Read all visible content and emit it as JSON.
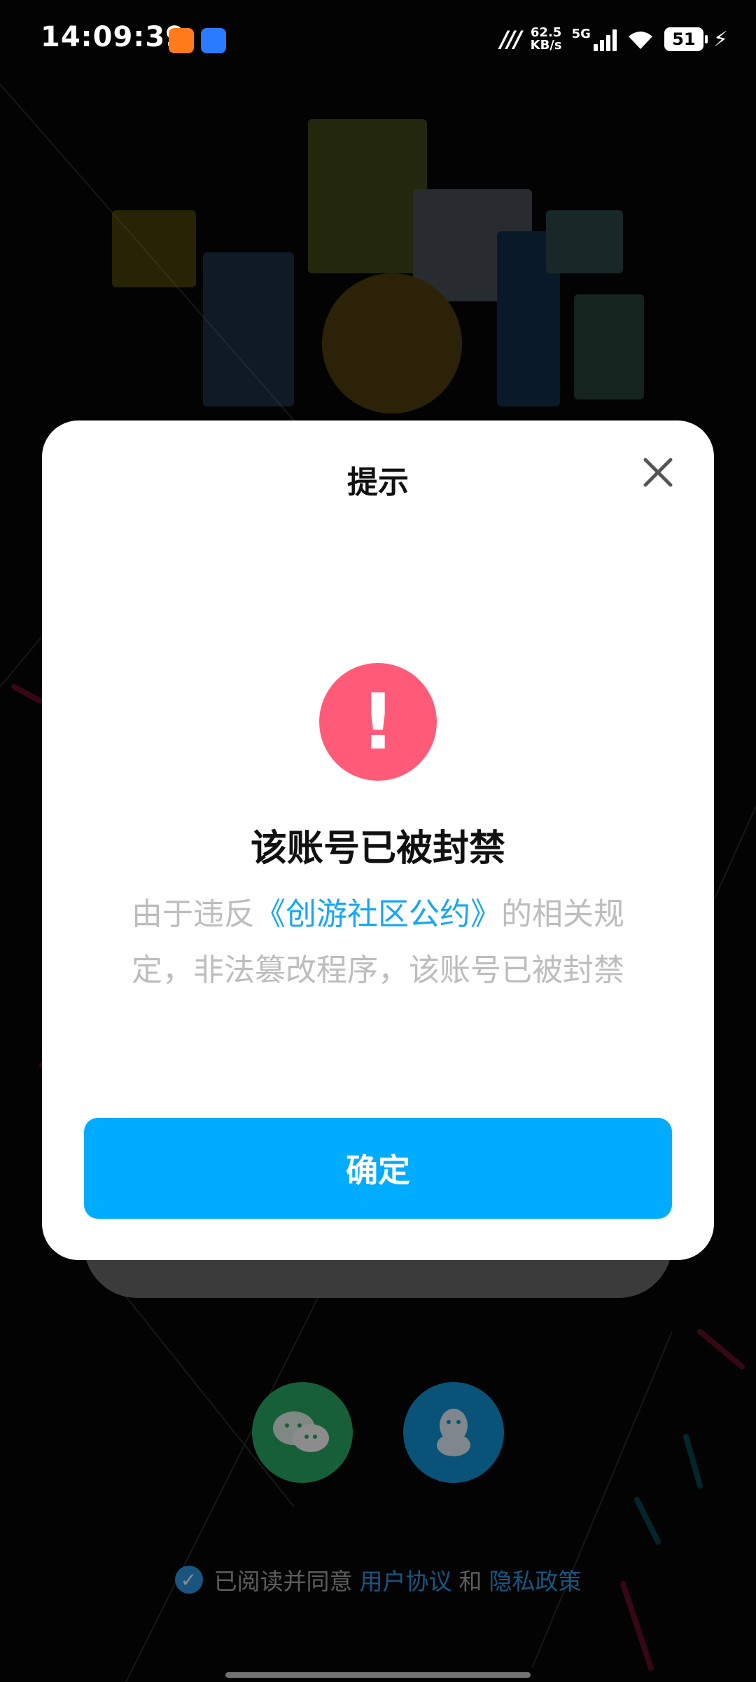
{
  "status_bar": {
    "time": "14:09:39",
    "net_speed_value": "62.5",
    "net_speed_unit": "KB/s",
    "network_type": "5G",
    "battery": "51"
  },
  "dialog": {
    "title": "提示",
    "heading": "该账号已被封禁",
    "desc_before": "由于违反",
    "desc_link": "《创游社区公约》",
    "desc_after": "的相关规定，非法篡改程序，该账号已被封禁",
    "confirm_label": "确定"
  },
  "agreement": {
    "prefix": "已阅读并同意",
    "user_agreement": "用户协议",
    "and": "和",
    "privacy_policy": "隐私政策"
  },
  "colors": {
    "accent_blue": "#00acff",
    "alert_red": "#ff5b78",
    "wechat_green": "#2aae67",
    "qq_blue": "#1296db"
  }
}
